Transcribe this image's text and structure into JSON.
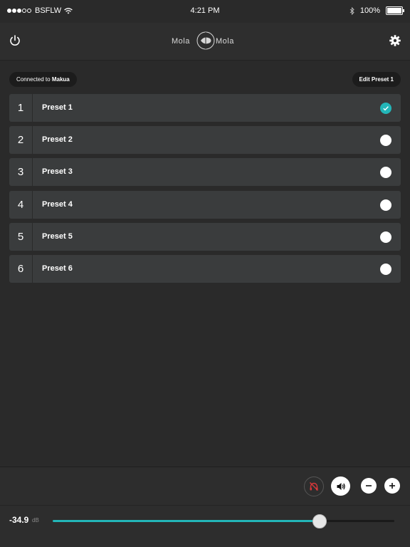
{
  "statusbar": {
    "carrier": "BSFLW",
    "time": "4:21 PM",
    "battery": "100%"
  },
  "header": {
    "logo_left": "Mola",
    "logo_right": "Mola"
  },
  "connection": {
    "prefix": "Connected to",
    "device": "Makua"
  },
  "edit_button_label": "Edit Preset 1",
  "presets": [
    {
      "number": "1",
      "name": "Preset 1",
      "selected": true
    },
    {
      "number": "2",
      "name": "Preset 2",
      "selected": false
    },
    {
      "number": "3",
      "name": "Preset 3",
      "selected": false
    },
    {
      "number": "4",
      "name": "Preset 4",
      "selected": false
    },
    {
      "number": "5",
      "name": "Preset 5",
      "selected": false
    },
    {
      "number": "6",
      "name": "Preset 6",
      "selected": false
    }
  ],
  "volume": {
    "value": "-34.9",
    "unit": "dB",
    "level_fraction": 0.78
  },
  "colors": {
    "accent": "#23b6b8",
    "mute_red": "#d9383a"
  },
  "icons": {
    "power": "power-icon",
    "settings": "gear-icon",
    "headphone_mute": "headphone-off-icon",
    "speaker": "speaker-icon",
    "minus": "minus-icon",
    "plus": "plus-icon",
    "check": "check-icon"
  }
}
